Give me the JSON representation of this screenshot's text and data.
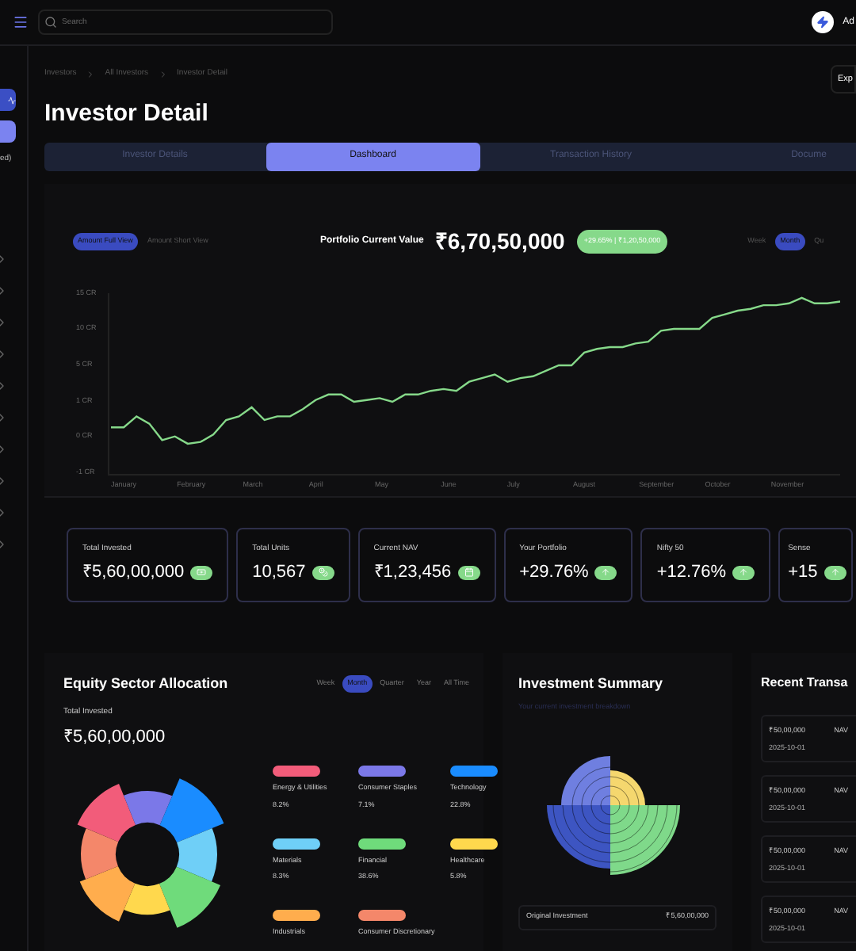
{
  "header": {
    "search": {
      "placeholder": "Search"
    },
    "user": "Ad"
  },
  "sidebar": {
    "items": [
      {
        "kind": "icon",
        "selected": true
      },
      {
        "kind": "icon",
        "selected": false
      },
      {
        "kind": "text",
        "label": "ed)"
      }
    ]
  },
  "breadcrumbs": [
    "Investors",
    "All Investors",
    "Investor Detail"
  ],
  "export_button": "Exp",
  "title": "Investor Detail",
  "tabs": [
    {
      "label": "Investor Details",
      "selected": false
    },
    {
      "label": "Dashboard",
      "selected": true
    },
    {
      "label": "Transaction History",
      "selected": false
    },
    {
      "label": "Docume",
      "selected": false
    }
  ],
  "portfolio": {
    "view_toggle": [
      {
        "label": "Amount Full View",
        "selected": true
      },
      {
        "label": "Amount Short View",
        "selected": false
      }
    ],
    "title": "Portfolio Current Value",
    "value": "₹6,70,50,000",
    "change": "+29.65% | ₹1,20,50,000",
    "period_toggle": [
      {
        "label": "Week",
        "selected": false
      },
      {
        "label": "Month",
        "selected": true
      },
      {
        "label": "Qu",
        "selected": false
      }
    ],
    "x_axis_labels": [
      "January",
      "February",
      "March",
      "April",
      "May",
      "June",
      "July",
      "August",
      "September",
      "October",
      "November"
    ],
    "y_axis_labels": [
      "15 CR",
      "10 CR",
      "5 CR",
      "1 CR",
      "0 CR",
      "-1 CR"
    ]
  },
  "stats": [
    {
      "label": "Total Invested",
      "value": "₹5,60,00,000"
    },
    {
      "label": "Total Units",
      "value": "10,567"
    },
    {
      "label": "Current NAV",
      "value": "₹1,23,456"
    },
    {
      "label": "Your Portfolio",
      "value": "+29.76%"
    },
    {
      "label": "Nifty 50",
      "value": "+12.76%"
    },
    {
      "label": "Sense",
      "value": "+15"
    }
  ],
  "equity": {
    "title": "Equity Sector Allocation",
    "periods": [
      {
        "label": "Week",
        "selected": false
      },
      {
        "label": "Month",
        "selected": true
      },
      {
        "label": "Quarter",
        "selected": false
      },
      {
        "label": "Year",
        "selected": false
      },
      {
        "label": "All Time",
        "selected": false
      }
    ],
    "total_label": "Total Invested",
    "total": "₹5,60,00,000",
    "sectors": [
      {
        "name": "Energy & Utilities",
        "share": "8.2%",
        "color": "#f25c7a"
      },
      {
        "name": "Consumer Staples",
        "share": "7.1%",
        "color": "#7b78e8"
      },
      {
        "name": "Technology",
        "share": "22.8%",
        "color": "#1a8cff"
      },
      {
        "name": "Materials",
        "share": "8.3%",
        "color": "#6fcff7"
      },
      {
        "name": "Financial",
        "share": "38.6%",
        "color": "#6fdb7b"
      },
      {
        "name": "Healthcare",
        "share": "5.8%",
        "color": "#ffd84d"
      },
      {
        "name": "Industrials",
        "color": "#ffad4d"
      },
      {
        "name": "Consumer Discretionary",
        "color": "#f4876a"
      }
    ]
  },
  "summary": {
    "title": "Investment Summary",
    "subtitle": "Your current investment breakdown",
    "rows": [
      {
        "label": "Original Investment",
        "value": "₹5,60,00,000"
      }
    ]
  },
  "transactions": {
    "title": "Recent Transa",
    "items": [
      {
        "amount": "₹50,00,000",
        "date": "2025-10-01",
        "type": "NAV"
      },
      {
        "amount": "₹50,00,000",
        "date": "2025-10-01",
        "type": "NAV"
      },
      {
        "amount": "₹50,00,000",
        "date": "2025-10-01",
        "type": "NAV"
      },
      {
        "amount": "₹50,00,000",
        "date": "2025-10-01",
        "type": "NAV"
      }
    ]
  }
}
